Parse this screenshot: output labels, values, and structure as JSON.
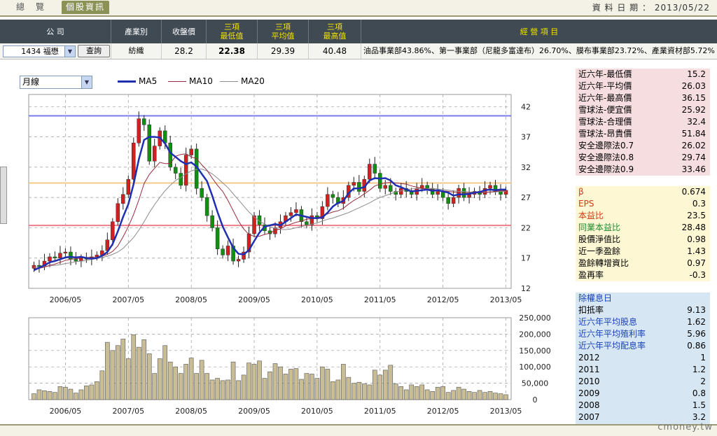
{
  "tabs": [
    "總　覽",
    "個股資訊"
  ],
  "date": {
    "label": "資 料 日 期 ：",
    "value": "2013/05/22"
  },
  "header": {
    "company": "公 司",
    "industry": "產業別",
    "close": "收盤價",
    "min": [
      "三項",
      "最低值"
    ],
    "avg": [
      "三項",
      "平均值"
    ],
    "max": [
      "三項",
      "最高值"
    ],
    "business": "經 營 項 目"
  },
  "row": {
    "stock_select": "1434 福懋",
    "query_button": "查詢",
    "industry": "紡織",
    "close": "28.2",
    "min": "22.38",
    "avg": "29.39",
    "max": "40.48",
    "business": "油品事業部43.86%、第一事業部（尼龍多富達布）26.70%、膜布事業部23.72%、產業資材部5.72%"
  },
  "period_select": "月線",
  "legend": [
    {
      "name": "MA5",
      "color": "#1f2fb0"
    },
    {
      "name": "MA10",
      "color": "#9a2c3c"
    },
    {
      "name": "MA20",
      "color": "#8c8c8c"
    }
  ],
  "chart_data": [
    {
      "type": "candlestick",
      "x_labels": [
        "2006/05",
        "2007/05",
        "2008/05",
        "2009/05",
        "2010/05",
        "2011/05",
        "2012/05",
        "2013/05"
      ],
      "y_ticks": [
        12,
        17,
        22,
        27,
        32,
        37,
        42
      ],
      "ylim": [
        12,
        44
      ],
      "reference_lines": [
        {
          "value": 40.48,
          "color": "#7b7bef"
        },
        {
          "value": 29.39,
          "color": "#f5c88a"
        },
        {
          "value": 22.38,
          "color": "#ef7e8c"
        }
      ],
      "months": [
        "2005/11",
        "2005/12",
        "2006/01",
        "2006/02",
        "2006/03",
        "2006/04",
        "2006/05",
        "2006/06",
        "2006/07",
        "2006/08",
        "2006/09",
        "2006/10",
        "2006/11",
        "2006/12",
        "2007/01",
        "2007/02",
        "2007/03",
        "2007/04",
        "2007/05",
        "2007/06",
        "2007/07",
        "2007/08",
        "2007/09",
        "2007/10",
        "2007/11",
        "2007/12",
        "2008/01",
        "2008/02",
        "2008/03",
        "2008/04",
        "2008/05",
        "2008/06",
        "2008/07",
        "2008/08",
        "2008/09",
        "2008/10",
        "2008/11",
        "2008/12",
        "2009/01",
        "2009/02",
        "2009/03",
        "2009/04",
        "2009/05",
        "2009/06",
        "2009/07",
        "2009/08",
        "2009/09",
        "2009/10",
        "2009/11",
        "2009/12",
        "2010/01",
        "2010/02",
        "2010/03",
        "2010/04",
        "2010/05",
        "2010/06",
        "2010/07",
        "2010/08",
        "2010/09",
        "2010/10",
        "2010/11",
        "2010/12",
        "2011/01",
        "2011/02",
        "2011/03",
        "2011/04",
        "2011/05",
        "2011/06",
        "2011/07",
        "2011/08",
        "2011/09",
        "2011/10",
        "2011/11",
        "2011/12",
        "2012/01",
        "2012/02",
        "2012/03",
        "2012/04",
        "2012/05",
        "2012/06",
        "2012/07",
        "2012/08",
        "2012/09",
        "2012/10",
        "2012/11",
        "2012/12",
        "2013/01",
        "2013/02",
        "2013/03",
        "2013/04",
        "2013/05"
      ],
      "close": [
        15.8,
        15.6,
        16.5,
        17.2,
        17.0,
        17.8,
        18.0,
        16.8,
        16.5,
        17.0,
        16.8,
        17.2,
        17.5,
        18.2,
        20.0,
        23.0,
        26.0,
        27.5,
        30.0,
        36.0,
        40.0,
        39.0,
        33.0,
        35.5,
        38.0,
        36.0,
        32.0,
        31.0,
        29.0,
        34.0,
        35.0,
        28.5,
        27.0,
        24.0,
        22.0,
        18.5,
        17.5,
        19.0,
        16.5,
        16.8,
        18.0,
        21.0,
        24.0,
        22.5,
        21.5,
        21.0,
        22.0,
        23.0,
        24.0,
        24.5,
        25.0,
        23.0,
        22.5,
        24.0,
        23.5,
        25.5,
        27.5,
        27.0,
        26.0,
        27.0,
        29.0,
        29.5,
        28.0,
        30.0,
        32.5,
        31.0,
        28.5,
        29.0,
        28.0,
        27.5,
        28.5,
        28.0,
        27.5,
        28.5,
        29.0,
        28.5,
        27.5,
        28.0,
        27.0,
        26.0,
        27.0,
        28.5,
        27.0,
        27.5,
        28.0,
        27.5,
        28.5,
        29.0,
        28.0,
        27.5,
        28.2
      ],
      "volume": [
        18000,
        30000,
        27000,
        25000,
        22000,
        40000,
        38000,
        32000,
        20000,
        30000,
        42000,
        45000,
        55000,
        88000,
        175000,
        150000,
        165000,
        185000,
        125000,
        198000,
        160000,
        183000,
        140000,
        80000,
        125000,
        165000,
        115000,
        100000,
        80000,
        108000,
        127000,
        80000,
        120000,
        80000,
        60000,
        65000,
        58000,
        60000,
        115000,
        58000,
        75000,
        112000,
        108000,
        118000,
        65000,
        85000,
        110000,
        100000,
        78000,
        93000,
        95000,
        62000,
        80000,
        78000,
        65000,
        100000,
        93000,
        55000,
        60000,
        108000,
        68000,
        50000,
        53000,
        48000,
        45000,
        90000,
        75000,
        90000,
        105000,
        48000,
        40000,
        30000,
        45000,
        40000,
        45000,
        30000,
        25000,
        38000,
        40000,
        22000,
        28000,
        38000,
        32000,
        25000,
        22000,
        28000,
        22000,
        25000,
        20000,
        18000,
        15000
      ],
      "ma5": [
        15.0,
        15.4,
        15.8,
        16.3,
        16.5,
        16.8,
        17.1,
        17.2,
        17.1,
        17.2,
        17.0,
        16.9,
        17.0,
        17.4,
        18.0,
        19.3,
        21.4,
        23.8,
        25.9,
        29.2,
        33.3,
        36.5,
        37.0,
        37.0,
        36.9,
        35.9,
        34.4,
        33.7,
        33.0,
        32.5,
        32.8,
        32.1,
        30.9,
        29.7,
        27.3,
        24.6,
        22.2,
        20.4,
        18.7,
        17.7,
        17.6,
        18.3,
        19.8,
        21.2,
        22.2,
        22.4,
        22.6,
        22.4,
        23.0,
        23.6,
        24.2,
        24.0,
        23.8,
        23.6,
        23.6,
        23.7,
        24.5,
        25.5,
        26.1,
        26.4,
        27.7,
        28.5,
        28.5,
        28.7,
        29.8,
        30.2,
        30.1,
        30.2,
        29.8,
        29.0,
        28.7,
        28.3,
        28.0,
        28.1,
        28.2,
        28.3,
        28.1,
        28.2,
        28.0,
        27.8,
        27.3,
        27.5,
        27.5,
        27.6,
        27.8,
        27.9,
        28.2,
        28.3,
        28.2,
        28.3,
        28.3
      ],
      "ma10": [
        15.2,
        15.3,
        15.5,
        15.8,
        16.0,
        16.3,
        16.6,
        16.8,
        16.9,
        17.0,
        17.1,
        17.1,
        17.1,
        17.3,
        17.6,
        18.1,
        19.0,
        20.5,
        22.2,
        24.2,
        26.6,
        29.3,
        30.8,
        31.8,
        32.8,
        32.6,
        32.6,
        33.8,
        34.1,
        34.2,
        33.7,
        33.4,
        32.4,
        31.5,
        30.2,
        29.0,
        28.0,
        26.5,
        24.8,
        23.1,
        21.8,
        20.9,
        20.6,
        20.6,
        20.9,
        21.1,
        21.6,
        21.8,
        22.3,
        22.6,
        22.9,
        23.1,
        23.4,
        23.5,
        23.7,
        23.9,
        24.3,
        24.6,
        24.8,
        25.2,
        25.9,
        26.5,
        27.0,
        27.6,
        28.2,
        28.9,
        29.2,
        29.4,
        29.5,
        29.4,
        29.3,
        29.2,
        28.9,
        28.7,
        28.5,
        28.4,
        28.3,
        28.2,
        28.1,
        28.0,
        27.9,
        27.8,
        27.8,
        27.8,
        27.8,
        27.8,
        27.8,
        27.9,
        28.0,
        28.1,
        28.1
      ],
      "ma20": [
        15.5,
        15.5,
        15.6,
        15.7,
        15.8,
        15.9,
        16.1,
        16.2,
        16.4,
        16.5,
        16.6,
        16.8,
        16.9,
        17.1,
        17.3,
        17.6,
        18.0,
        18.6,
        19.5,
        20.4,
        21.6,
        23.0,
        24.5,
        25.8,
        27.0,
        28.1,
        29.0,
        29.8,
        30.3,
        30.9,
        31.4,
        31.6,
        31.7,
        31.4,
        30.9,
        30.2,
        29.4,
        28.6,
        27.6,
        26.6,
        25.6,
        24.6,
        23.8,
        23.1,
        22.6,
        22.2,
        21.9,
        21.7,
        21.7,
        21.8,
        22.0,
        22.2,
        22.4,
        22.6,
        22.8,
        23.1,
        23.4,
        23.6,
        23.9,
        24.2,
        24.5,
        24.9,
        25.3,
        25.7,
        26.1,
        26.6,
        27.0,
        27.3,
        27.6,
        27.9,
        28.1,
        28.3,
        28.4,
        28.5,
        28.5,
        28.5,
        28.5,
        28.4,
        28.3,
        28.2,
        28.1,
        28.0,
        28.0,
        27.9,
        27.9,
        27.9,
        27.9,
        27.9,
        27.9,
        28.0,
        28.0
      ],
      "volume_ticks": [
        "0",
        "50,000",
        "100,000",
        "150,000",
        "200,000",
        "250,000"
      ],
      "volume_max": 250000
    }
  ],
  "panel_price": [
    {
      "k": "近六年-最低價",
      "v": "15.2"
    },
    {
      "k": "近六年-平均價",
      "v": "26.03"
    },
    {
      "k": "近六年-最高價",
      "v": "36.15"
    },
    {
      "k": "雪球法-便宜價",
      "v": "25.92"
    },
    {
      "k": "雪球法-合理價",
      "v": "32.4"
    },
    {
      "k": "雪球法-昂貴價",
      "v": "51.84"
    },
    {
      "k": "安全邊際法0.7",
      "v": "26.02"
    },
    {
      "k": "安全邊際法0.8",
      "v": "29.74"
    },
    {
      "k": "安全邊際法0.9",
      "v": "33.46"
    }
  ],
  "panel_ratio": [
    {
      "k": "β",
      "v": "0.674",
      "color": "#d23b12"
    },
    {
      "k": "EPS",
      "v": "0.3",
      "color": "#d23b12"
    },
    {
      "k": "本益比",
      "v": "23.5",
      "color": "#d23b12"
    },
    {
      "k": "同業本益比",
      "v": "28.48",
      "color": "#1e8a2e"
    },
    {
      "k": "股價淨值比",
      "v": "0.98",
      "color": "#000000"
    },
    {
      "k": "近一季盈餘",
      "v": "1.43",
      "color": "#000000"
    },
    {
      "k": "盈餘轉增資比",
      "v": "0.97",
      "color": "#000000"
    },
    {
      "k": "盈再率",
      "v": "-0.3",
      "color": "#000000"
    }
  ],
  "panel_div": [
    {
      "k": "除權息日",
      "v": "",
      "color": "#1a43b8"
    },
    {
      "k": "扣抵率",
      "v": "9.13",
      "color": "#000000"
    },
    {
      "k": "近六年平均股息",
      "v": "1.62",
      "color": "#1a43b8"
    },
    {
      "k": "近六年平均殖利率",
      "v": "5.96",
      "color": "#1a43b8"
    },
    {
      "k": "近六年平均配息率",
      "v": "0.86",
      "color": "#1a43b8"
    },
    {
      "k": "2012",
      "v": "1",
      "color": "#000000"
    },
    {
      "k": "2011",
      "v": "1.2",
      "color": "#000000"
    },
    {
      "k": "2010",
      "v": "2",
      "color": "#000000"
    },
    {
      "k": "2009",
      "v": "0.8",
      "color": "#000000"
    },
    {
      "k": "2008",
      "v": "1.5",
      "color": "#000000"
    },
    {
      "k": "2007",
      "v": "3.2",
      "color": "#000000"
    }
  ],
  "watermark": "cmoney.tw"
}
